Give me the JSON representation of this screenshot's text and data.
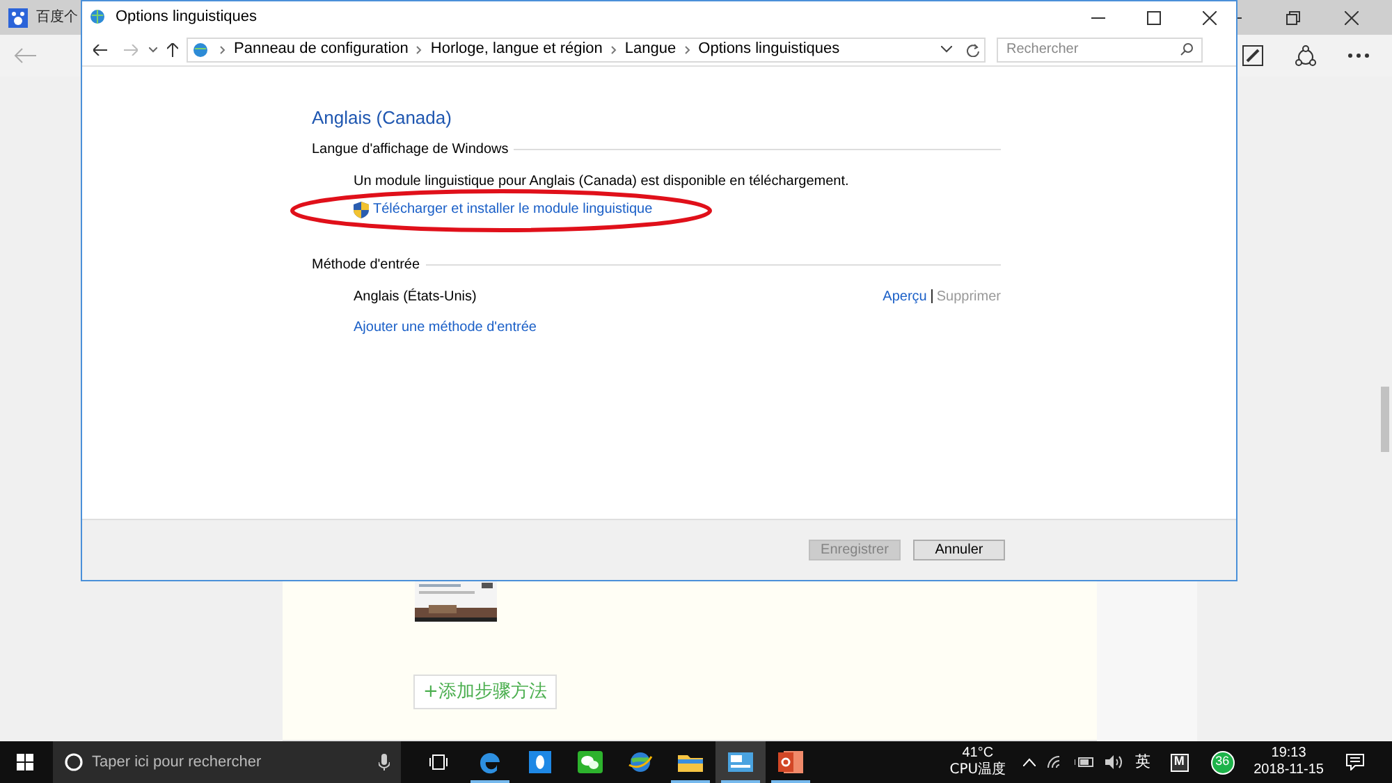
{
  "browser": {
    "tab_title": "百度个"
  },
  "browser_page": {
    "add_step_button": "+添加步骤方法"
  },
  "dialog": {
    "title": "Options linguistiques",
    "breadcrumb": [
      "Panneau de configuration",
      "Horloge, langue et région",
      "Langue",
      "Options linguistiques"
    ],
    "search": {
      "placeholder": "Rechercher"
    },
    "heading": "Anglais (Canada)",
    "sections": [
      {
        "kind": "display",
        "title": "Langue d'affichage de Windows",
        "message": "Un module linguistique pour Anglais (Canada) est disponible en téléchargement.",
        "link": "Télécharger et installer le module linguistique"
      },
      {
        "kind": "input",
        "title": "Méthode d'entrée",
        "methods": [
          {
            "name": "Anglais (États-Unis)",
            "actions": [
              {
                "label": "Aperçu",
                "disabled": false
              },
              {
                "label": "Supprimer",
                "disabled": true
              }
            ]
          }
        ],
        "link": "Ajouter une méthode d'entrée"
      }
    ],
    "buttons": [
      {
        "label": "Enregistrer",
        "disabled": true
      },
      {
        "label": "Annuler",
        "disabled": false
      }
    ]
  },
  "taskbar": {
    "search_placeholder": "Taper ici pour rechercher",
    "apps": [
      {
        "kind": "edge",
        "running": true,
        "selected": false
      },
      {
        "kind": "qq",
        "running": false,
        "selected": false
      },
      {
        "kind": "wechat",
        "running": false,
        "selected": false
      },
      {
        "kind": "globe",
        "running": false,
        "selected": false
      },
      {
        "kind": "folder",
        "running": true,
        "selected": false
      },
      {
        "kind": "control",
        "running": true,
        "selected": true
      },
      {
        "kind": "ppt",
        "running": true,
        "selected": false
      }
    ],
    "cpu_temp": "41°C",
    "cpu_label": "CPU温度",
    "ime": "英",
    "ime_mode": "M",
    "badge": "36",
    "time": "19:13",
    "date": "2018-11-15"
  }
}
